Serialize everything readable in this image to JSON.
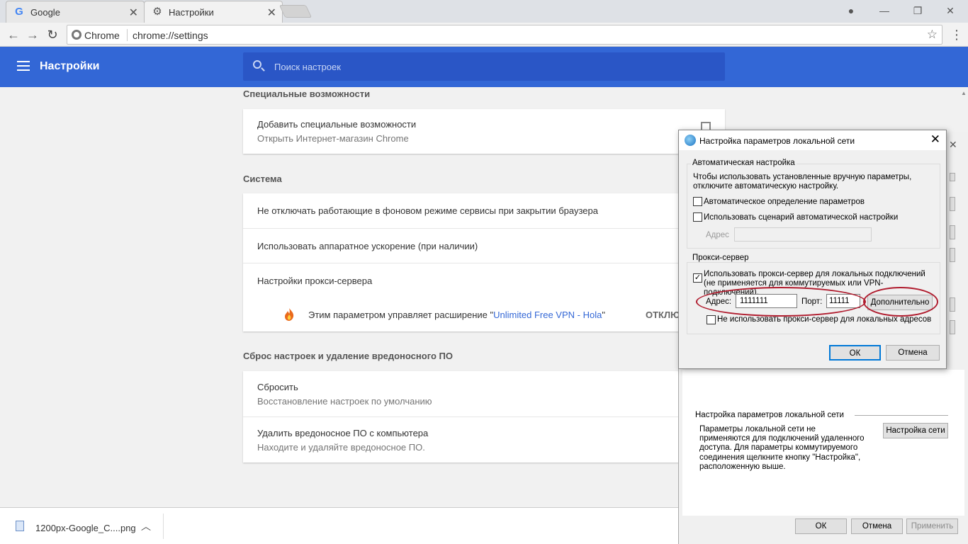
{
  "browser": {
    "tabs": [
      {
        "title": "Google",
        "icon": "google-g-icon"
      },
      {
        "title": "Настройки",
        "icon": "gear-icon"
      }
    ],
    "omnibox": {
      "chip": "Chrome",
      "url": "chrome://settings"
    }
  },
  "settings": {
    "header_title": "Настройки",
    "search_placeholder": "Поиск настроек",
    "sections": {
      "accessibility": {
        "title": "Специальные возможности",
        "add_title": "Добавить специальные возможности",
        "add_subtitle": "Открыть Интернет-магазин Chrome"
      },
      "system": {
        "title": "Система",
        "background_apps": "Не отключать работающие в фоновом режиме сервисы при закрытии браузера",
        "hardware_accel": "Использовать аппаратное ускорение (при наличии)",
        "proxy": "Настройки прокси-сервера",
        "extension_prefix": "Этим параметром управляет расширение \"",
        "extension_name": "Unlimited Free VPN - Hola",
        "extension_suffix": "\"",
        "disable_label": "ОТКЛЮ"
      },
      "reset": {
        "title": "Сброс настроек и удаление вредоносного ПО",
        "reset_title": "Сбросить",
        "reset_subtitle": "Восстановление настроек по умолчанию",
        "cleanup_title": "Удалить вредоносное ПО с компьютера",
        "cleanup_subtitle": "Находите и удаляйте вредоносное ПО."
      }
    }
  },
  "download": {
    "filename": "1200px-Google_C....png"
  },
  "inet_props": {
    "lan_group_title": "Настройка параметров локальной сети",
    "lan_group_text": "Параметры локальной сети не применяются для подключений удаленного доступа. Для параметры коммутируемого соединения щелкните кнопку \"Настройка\", расположенную выше.",
    "lan_settings_button": "Настройка сети",
    "ok": "ОК",
    "cancel": "Отмена",
    "apply": "Применить"
  },
  "lan_dialog": {
    "title": "Настройка параметров локальной сети",
    "auto_group": "Автоматическая настройка",
    "auto_desc": "Чтобы использовать установленные вручную параметры, отключите автоматическую настройку.",
    "auto_detect": "Автоматическое определение параметров",
    "auto_detect_checked": false,
    "auto_script": "Использовать сценарий автоматической настройки",
    "auto_script_checked": false,
    "script_address_label": "Адрес",
    "script_address_value": "",
    "proxy_group": "Прокси-сервер",
    "use_proxy": "Использовать прокси-сервер для локальных подключений (не применяется для коммутируемых или VPN-подключений).",
    "use_proxy_checked": true,
    "address_label": "Адрес:",
    "address_value": "1111111",
    "port_label": "Порт:",
    "port_value": "11111",
    "advanced_button": "Дополнительно",
    "bypass_local": "Не использовать прокси-сервер для локальных адресов",
    "bypass_local_checked": false,
    "ok": "ОК",
    "cancel": "Отмена"
  }
}
